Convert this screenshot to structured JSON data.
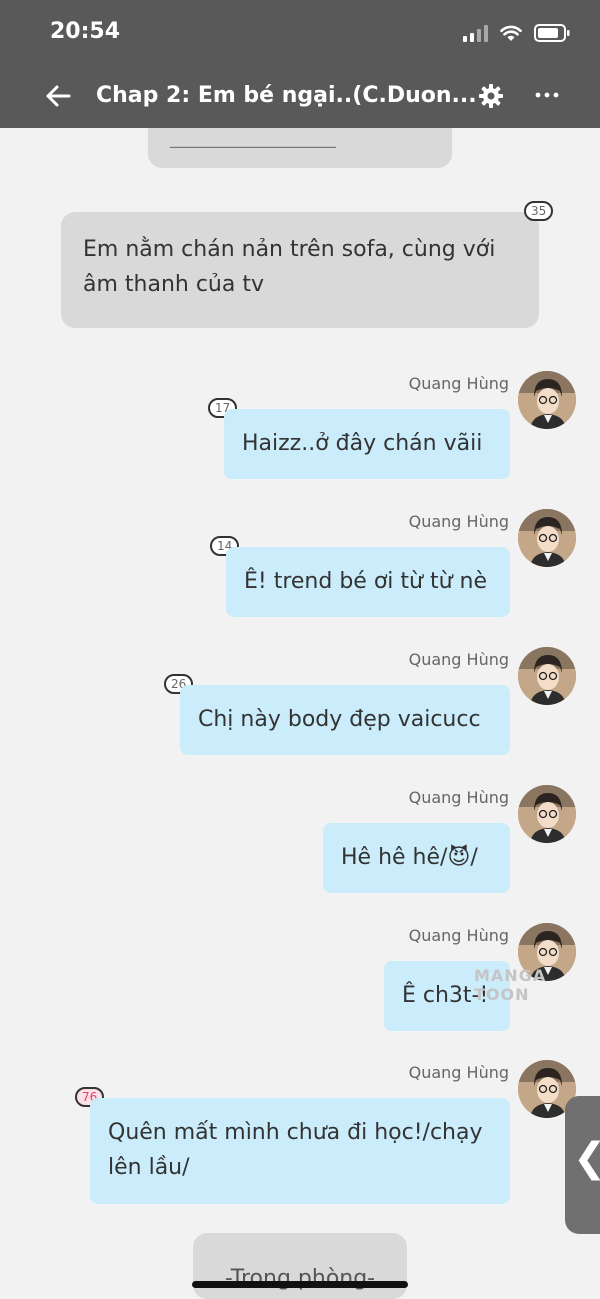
{
  "status_bar": {
    "time": "20:54"
  },
  "header": {
    "title": "Chap 2: Em bé ngại..(C.Duon..."
  },
  "narration_top": {
    "text": "______________________"
  },
  "narration_main": {
    "text": "Em nằm chán nản trên sofa, cùng với âm thanh của tv",
    "count": "35"
  },
  "messages": [
    {
      "sender": "Quang Hùng",
      "text": "Haizz..ở đây chán vãii",
      "count": "17"
    },
    {
      "sender": "Quang Hùng",
      "text": "Ê! trend bé ơi từ từ nè",
      "count": "14"
    },
    {
      "sender": "Quang Hùng",
      "text": "Chị này body đẹp vaicucc",
      "count": "26"
    },
    {
      "sender": "Quang Hùng",
      "text": "Hê hê hê/😈/"
    },
    {
      "sender": "Quang Hùng",
      "text": "Ê ch3t-!"
    },
    {
      "sender": "Quang Hùng",
      "text": "Quên mất mình chưa đi học!/chạy lên lầu/",
      "count": "76"
    }
  ],
  "narration_bottom": {
    "text": "-Trong phòng-"
  },
  "watermark": "MANGA TOON",
  "side_handle": {
    "icon": "chevron-left-icon",
    "glyph": "❮"
  },
  "colors": {
    "bubble": "#cbecfb",
    "narration": "#d9d9d9",
    "header": "#595959",
    "background": "#f2f2f2"
  }
}
